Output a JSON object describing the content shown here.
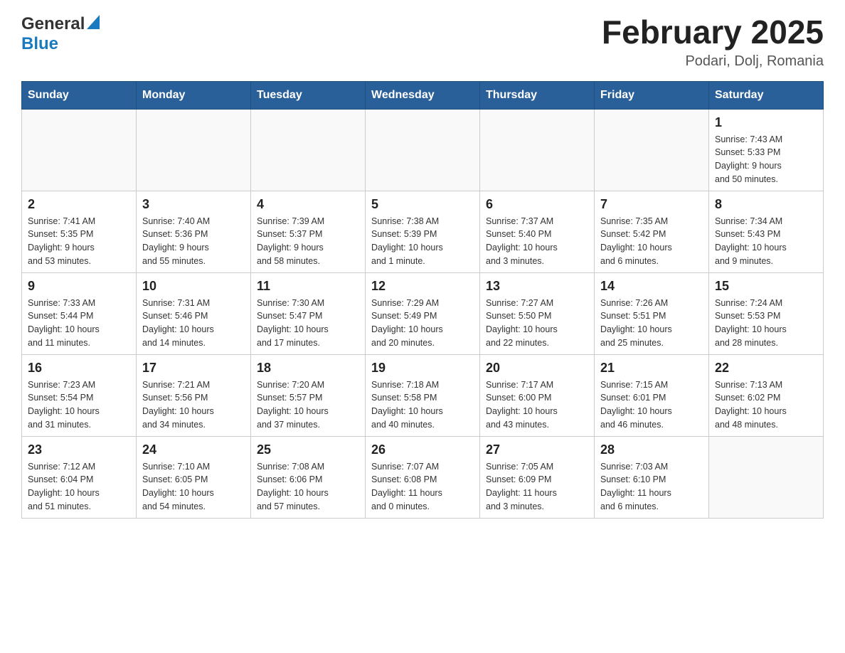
{
  "header": {
    "logo": {
      "general": "General",
      "triangle": "▶",
      "blue": "Blue"
    },
    "title": "February 2025",
    "location": "Podari, Dolj, Romania"
  },
  "weekdays": [
    "Sunday",
    "Monday",
    "Tuesday",
    "Wednesday",
    "Thursday",
    "Friday",
    "Saturday"
  ],
  "weeks": [
    [
      {
        "day": "",
        "info": ""
      },
      {
        "day": "",
        "info": ""
      },
      {
        "day": "",
        "info": ""
      },
      {
        "day": "",
        "info": ""
      },
      {
        "day": "",
        "info": ""
      },
      {
        "day": "",
        "info": ""
      },
      {
        "day": "1",
        "info": "Sunrise: 7:43 AM\nSunset: 5:33 PM\nDaylight: 9 hours\nand 50 minutes."
      }
    ],
    [
      {
        "day": "2",
        "info": "Sunrise: 7:41 AM\nSunset: 5:35 PM\nDaylight: 9 hours\nand 53 minutes."
      },
      {
        "day": "3",
        "info": "Sunrise: 7:40 AM\nSunset: 5:36 PM\nDaylight: 9 hours\nand 55 minutes."
      },
      {
        "day": "4",
        "info": "Sunrise: 7:39 AM\nSunset: 5:37 PM\nDaylight: 9 hours\nand 58 minutes."
      },
      {
        "day": "5",
        "info": "Sunrise: 7:38 AM\nSunset: 5:39 PM\nDaylight: 10 hours\nand 1 minute."
      },
      {
        "day": "6",
        "info": "Sunrise: 7:37 AM\nSunset: 5:40 PM\nDaylight: 10 hours\nand 3 minutes."
      },
      {
        "day": "7",
        "info": "Sunrise: 7:35 AM\nSunset: 5:42 PM\nDaylight: 10 hours\nand 6 minutes."
      },
      {
        "day": "8",
        "info": "Sunrise: 7:34 AM\nSunset: 5:43 PM\nDaylight: 10 hours\nand 9 minutes."
      }
    ],
    [
      {
        "day": "9",
        "info": "Sunrise: 7:33 AM\nSunset: 5:44 PM\nDaylight: 10 hours\nand 11 minutes."
      },
      {
        "day": "10",
        "info": "Sunrise: 7:31 AM\nSunset: 5:46 PM\nDaylight: 10 hours\nand 14 minutes."
      },
      {
        "day": "11",
        "info": "Sunrise: 7:30 AM\nSunset: 5:47 PM\nDaylight: 10 hours\nand 17 minutes."
      },
      {
        "day": "12",
        "info": "Sunrise: 7:29 AM\nSunset: 5:49 PM\nDaylight: 10 hours\nand 20 minutes."
      },
      {
        "day": "13",
        "info": "Sunrise: 7:27 AM\nSunset: 5:50 PM\nDaylight: 10 hours\nand 22 minutes."
      },
      {
        "day": "14",
        "info": "Sunrise: 7:26 AM\nSunset: 5:51 PM\nDaylight: 10 hours\nand 25 minutes."
      },
      {
        "day": "15",
        "info": "Sunrise: 7:24 AM\nSunset: 5:53 PM\nDaylight: 10 hours\nand 28 minutes."
      }
    ],
    [
      {
        "day": "16",
        "info": "Sunrise: 7:23 AM\nSunset: 5:54 PM\nDaylight: 10 hours\nand 31 minutes."
      },
      {
        "day": "17",
        "info": "Sunrise: 7:21 AM\nSunset: 5:56 PM\nDaylight: 10 hours\nand 34 minutes."
      },
      {
        "day": "18",
        "info": "Sunrise: 7:20 AM\nSunset: 5:57 PM\nDaylight: 10 hours\nand 37 minutes."
      },
      {
        "day": "19",
        "info": "Sunrise: 7:18 AM\nSunset: 5:58 PM\nDaylight: 10 hours\nand 40 minutes."
      },
      {
        "day": "20",
        "info": "Sunrise: 7:17 AM\nSunset: 6:00 PM\nDaylight: 10 hours\nand 43 minutes."
      },
      {
        "day": "21",
        "info": "Sunrise: 7:15 AM\nSunset: 6:01 PM\nDaylight: 10 hours\nand 46 minutes."
      },
      {
        "day": "22",
        "info": "Sunrise: 7:13 AM\nSunset: 6:02 PM\nDaylight: 10 hours\nand 48 minutes."
      }
    ],
    [
      {
        "day": "23",
        "info": "Sunrise: 7:12 AM\nSunset: 6:04 PM\nDaylight: 10 hours\nand 51 minutes."
      },
      {
        "day": "24",
        "info": "Sunrise: 7:10 AM\nSunset: 6:05 PM\nDaylight: 10 hours\nand 54 minutes."
      },
      {
        "day": "25",
        "info": "Sunrise: 7:08 AM\nSunset: 6:06 PM\nDaylight: 10 hours\nand 57 minutes."
      },
      {
        "day": "26",
        "info": "Sunrise: 7:07 AM\nSunset: 6:08 PM\nDaylight: 11 hours\nand 0 minutes."
      },
      {
        "day": "27",
        "info": "Sunrise: 7:05 AM\nSunset: 6:09 PM\nDaylight: 11 hours\nand 3 minutes."
      },
      {
        "day": "28",
        "info": "Sunrise: 7:03 AM\nSunset: 6:10 PM\nDaylight: 11 hours\nand 6 minutes."
      },
      {
        "day": "",
        "info": ""
      }
    ]
  ]
}
